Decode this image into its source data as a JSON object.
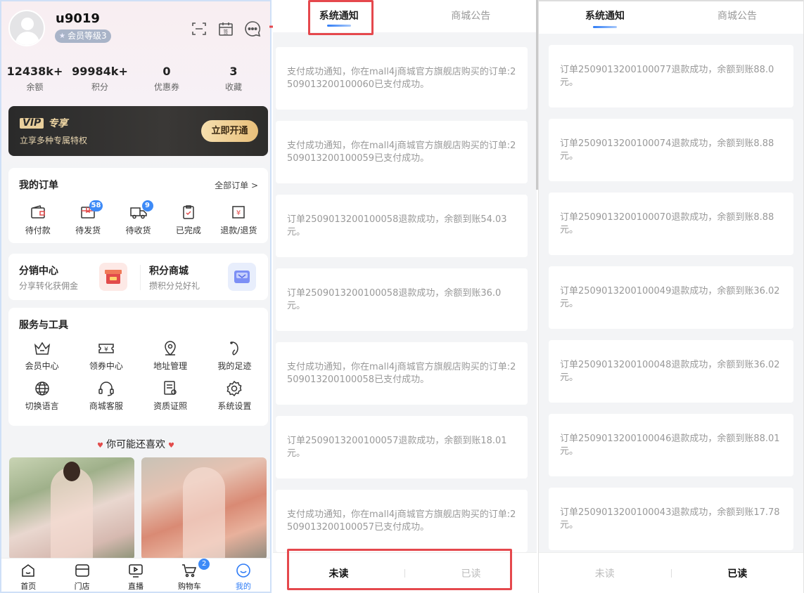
{
  "profile": {
    "username": "u9019",
    "level": "会员等级3",
    "stats": [
      {
        "value": "12438k+",
        "label": "余额"
      },
      {
        "value": "99984k+",
        "label": "积分"
      },
      {
        "value": "0",
        "label": "优惠券"
      },
      {
        "value": "3",
        "label": "收藏"
      }
    ],
    "vip": {
      "logo": "VIP",
      "title": "专享",
      "subtitle": "立享多种专属特权",
      "button": "立即开通"
    },
    "orders": {
      "title": "我的订单",
      "more": "全部订单 >",
      "items": [
        {
          "label": "待付款",
          "icon": "wallet-icon",
          "badge": ""
        },
        {
          "label": "待发货",
          "icon": "package-icon",
          "badge": "58"
        },
        {
          "label": "待收货",
          "icon": "truck-icon",
          "badge": "9"
        },
        {
          "label": "已完成",
          "icon": "clipboard-check-icon",
          "badge": ""
        },
        {
          "label": "退款/退货",
          "icon": "refund-icon",
          "badge": ""
        }
      ]
    },
    "distribution": {
      "title": "分销中心",
      "subtitle": "分享转化获佣金"
    },
    "points_mall": {
      "title": "积分商城",
      "subtitle": "攒积分兑好礼"
    },
    "services": {
      "title": "服务与工具",
      "items": [
        {
          "label": "会员中心",
          "icon": "crown-icon"
        },
        {
          "label": "领券中心",
          "icon": "coupon-icon"
        },
        {
          "label": "地址管理",
          "icon": "location-icon"
        },
        {
          "label": "我的足迹",
          "icon": "footprint-icon"
        },
        {
          "label": "切换语言",
          "icon": "globe-icon"
        },
        {
          "label": "商城客服",
          "icon": "headset-icon"
        },
        {
          "label": "资质证照",
          "icon": "certificate-icon"
        },
        {
          "label": "系统设置",
          "icon": "gear-icon"
        }
      ]
    },
    "recommend_title": "你可能还喜欢",
    "tabbar": [
      {
        "label": "首页",
        "icon": "home-icon"
      },
      {
        "label": "门店",
        "icon": "store-icon"
      },
      {
        "label": "直播",
        "icon": "live-icon"
      },
      {
        "label": "购物车",
        "icon": "cart-icon",
        "badge": "2"
      },
      {
        "label": "我的",
        "icon": "smile-icon",
        "active": true
      }
    ]
  },
  "unread": {
    "tabs": [
      "系统通知",
      "商城公告"
    ],
    "messages": [
      "支付成功通知，你在mall4j商城官方旗舰店购买的订单:2509013200100060已支付成功。",
      "支付成功通知，你在mall4j商城官方旗舰店购买的订单:2509013200100059已支付成功。",
      "订单2509013200100058退款成功，余额到账54.03元。",
      "订单2509013200100058退款成功，余额到账36.0元。",
      "支付成功通知，你在mall4j商城官方旗舰店购买的订单:2509013200100058已支付成功。",
      "订单2509013200100057退款成功，余额到账18.01元。",
      "支付成功通知，你在mall4j商城官方旗舰店购买的订单:2509013200100057已支付成功。"
    ],
    "read_tabs": [
      "未读",
      "已读"
    ]
  },
  "read": {
    "tabs": [
      "系统通知",
      "商城公告"
    ],
    "messages": [
      "订单2509013200100077退款成功，余额到账88.0元。",
      "订单2509013200100074退款成功，余额到账8.88元。",
      "订单2509013200100070退款成功，余额到账8.88元。",
      "订单2509013200100049退款成功，余额到账36.02元。",
      "订单2509013200100048退款成功，余额到账36.02元。",
      "订单2509013200100046退款成功，余额到账88.01元。",
      "订单2509013200100043退款成功，余额到账17.78元。"
    ],
    "read_tabs": [
      "未读",
      "已读"
    ]
  },
  "colors": {
    "accent": "#2f7cf6",
    "highlight": "#e5484d",
    "badge": "#3d8af7"
  }
}
